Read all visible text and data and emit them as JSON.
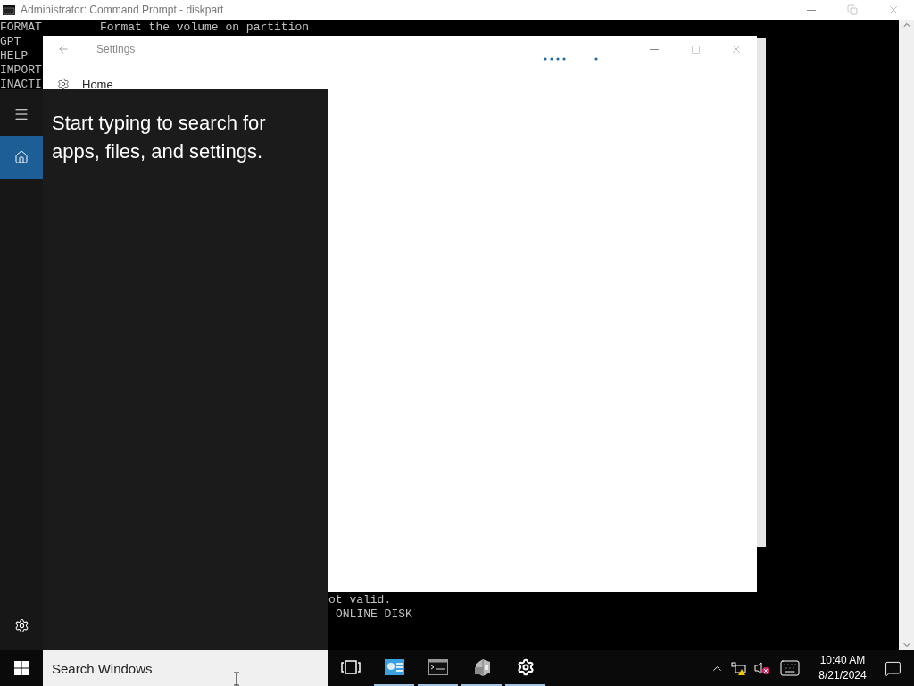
{
  "cmd_window": {
    "title": "Administrator: Command Prompt - diskpart",
    "lines": [
      {
        "command": "FORMAT",
        "description": "Format the volume on partition"
      },
      {
        "command": "GPT"
      },
      {
        "command": "HELP"
      },
      {
        "command": "IMPORT"
      },
      {
        "command": "INACTI"
      }
    ],
    "bottom_lines": [
      "ot valid.",
      "ONLINE DISK"
    ]
  },
  "settings_window": {
    "title": "Settings",
    "loading": true,
    "nav_items": [
      {
        "label": "Home"
      }
    ]
  },
  "start_menu": {
    "prompt": "Start typing to search for apps, files, and settings.",
    "rail_items": [
      {
        "kind": "menu",
        "selected": false
      },
      {
        "kind": "home",
        "selected": true
      },
      {
        "kind": "settings",
        "selected": false
      }
    ]
  },
  "taskbar": {
    "search": {
      "placeholder": "Search Windows"
    },
    "apps": [
      {
        "kind": "task-view",
        "running": false
      },
      {
        "kind": "server-manager",
        "running": true
      },
      {
        "kind": "terminal",
        "running": true
      },
      {
        "kind": "drive",
        "running": true
      },
      {
        "kind": "settings",
        "running": true
      }
    ],
    "clock": {
      "time": "10:40 AM",
      "date": "8/21/2024"
    }
  }
}
